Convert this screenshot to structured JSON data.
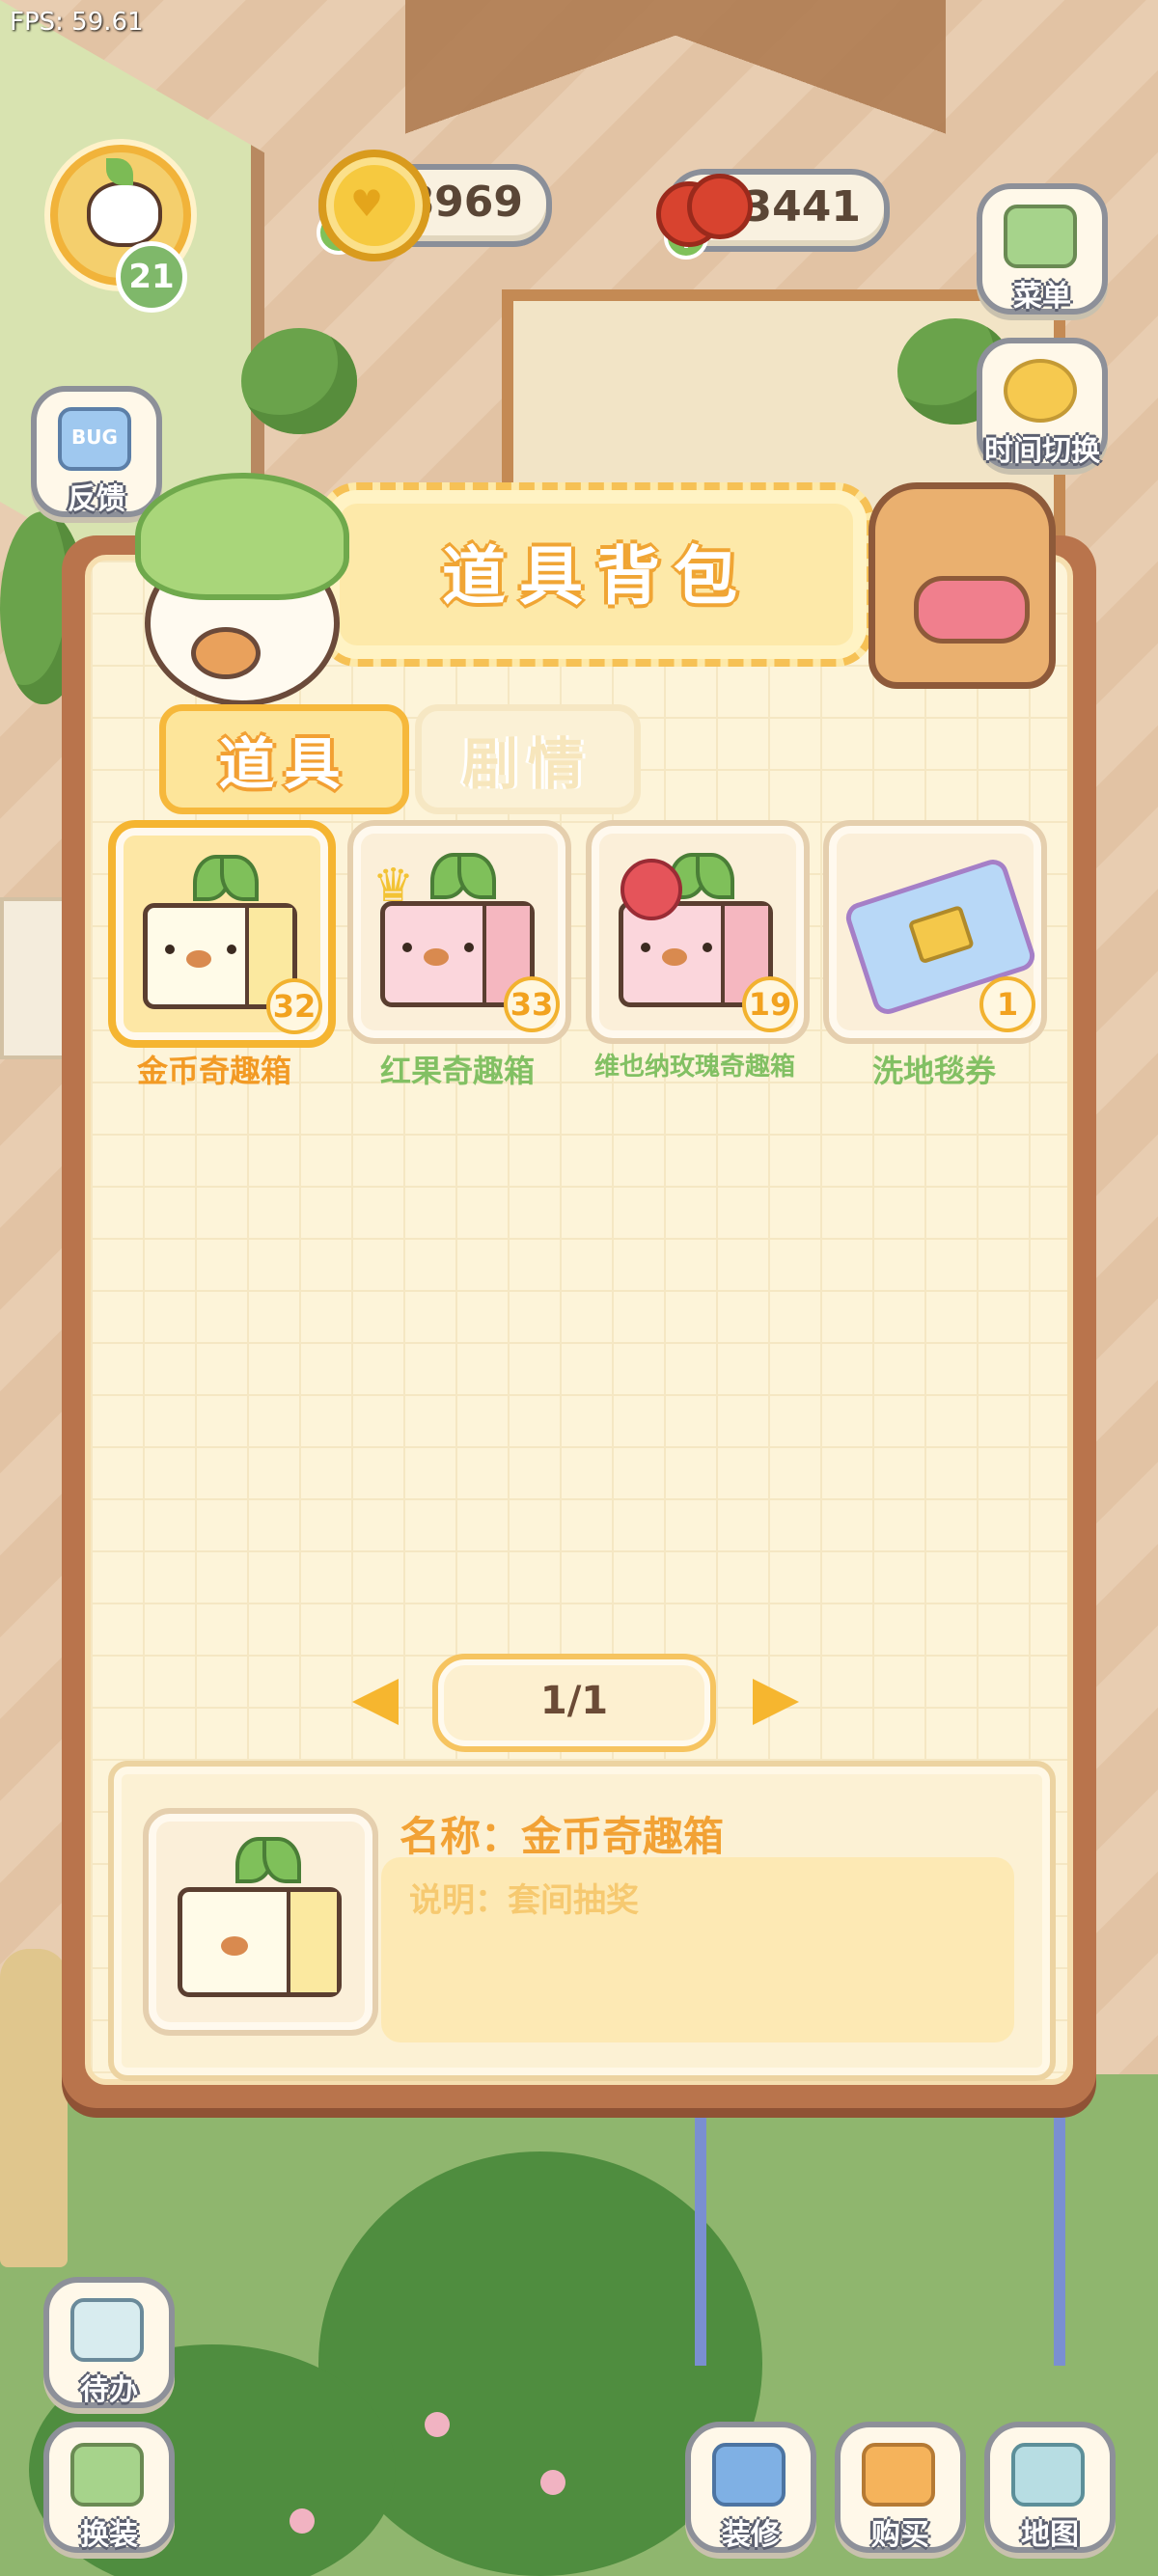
{
  "hud": {
    "fps": "FPS: 59.61",
    "level": "21",
    "gold": "8969",
    "redfruit": "3441",
    "plus": "+"
  },
  "side_buttons": {
    "menu": "菜单",
    "time_switch": "时间切换",
    "feedback": "反馈",
    "feedback_icon_text": "BUG",
    "todo": "待办",
    "dressup": "换装",
    "decorate": "装修",
    "buy": "购买",
    "map": "地图"
  },
  "modal": {
    "title": "道具背包",
    "tabs": [
      {
        "label": "道具",
        "active": true
      },
      {
        "label": "剧情",
        "active": false
      }
    ],
    "items": [
      {
        "name": "金币奇趣箱",
        "count": "32",
        "selected": true,
        "name_color": "#f29a24"
      },
      {
        "name": "红果奇趣箱",
        "count": "33",
        "selected": false,
        "name_color": "#82c063"
      },
      {
        "name": "维也纳玫瑰奇趣箱",
        "count": "19",
        "selected": false,
        "name_color": "#82c063"
      },
      {
        "name": "洗地毯券",
        "count": "1",
        "selected": false,
        "name_color": "#82c063"
      }
    ],
    "pager": "1/1",
    "detail": {
      "name": "名称：金币奇趣箱",
      "desc": "说明：套间抽奖"
    }
  }
}
